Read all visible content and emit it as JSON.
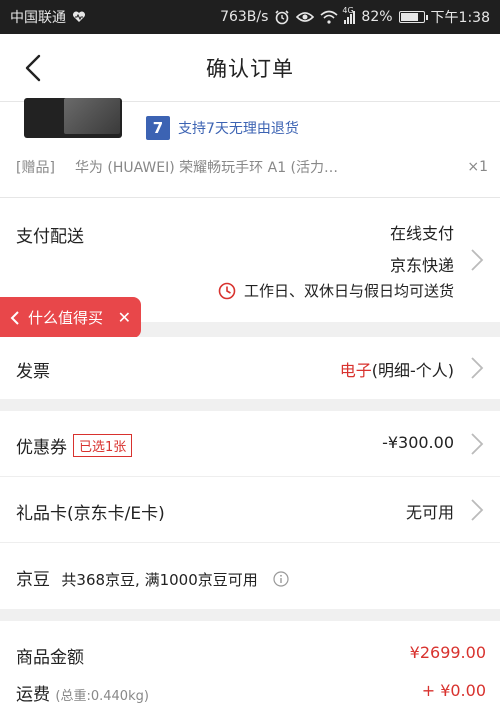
{
  "status_bar": {
    "carrier": "中国联通",
    "speed": "763B/s",
    "signal_label": "4G",
    "battery": "82%",
    "battery_level": 0.82,
    "time": "下午1:38"
  },
  "header": {
    "title": "确认订单"
  },
  "product": {
    "guarantee_badge": "7",
    "guarantee_text": "支持7天无理由退货",
    "gift_tag": "[赠品]",
    "gift_name": "华为 (HUAWEI) 荣耀畅玩手环 A1 (活力…",
    "gift_qty": "×1"
  },
  "payment": {
    "label": "支付配送",
    "method": "在线支付",
    "express": "京东快递",
    "delivery_time": "工作日、双休日与假日均可送货"
  },
  "float_tag": {
    "label": "什么值得买",
    "close": "✕"
  },
  "invoice": {
    "label": "发票",
    "type": "电子",
    "detail": "(明细-个人)"
  },
  "coupon": {
    "label": "优惠券",
    "badge": "已选1张",
    "value": "-¥300.00"
  },
  "gift_card": {
    "label": "礼品卡(京东卡/E卡)",
    "value": "无可用"
  },
  "jd_beans": {
    "label": "京豆",
    "text": "共368京豆, 满1000京豆可用"
  },
  "totals": {
    "goods_label": "商品金额",
    "goods_value": "¥2699.00",
    "shipping_label": "运费",
    "shipping_weight": "(总重:0.440kg)",
    "shipping_value": "+ ¥0.00"
  },
  "colors": {
    "accent_red": "#d8322e",
    "blue": "#3c63b3",
    "float_red": "#e8474a"
  }
}
